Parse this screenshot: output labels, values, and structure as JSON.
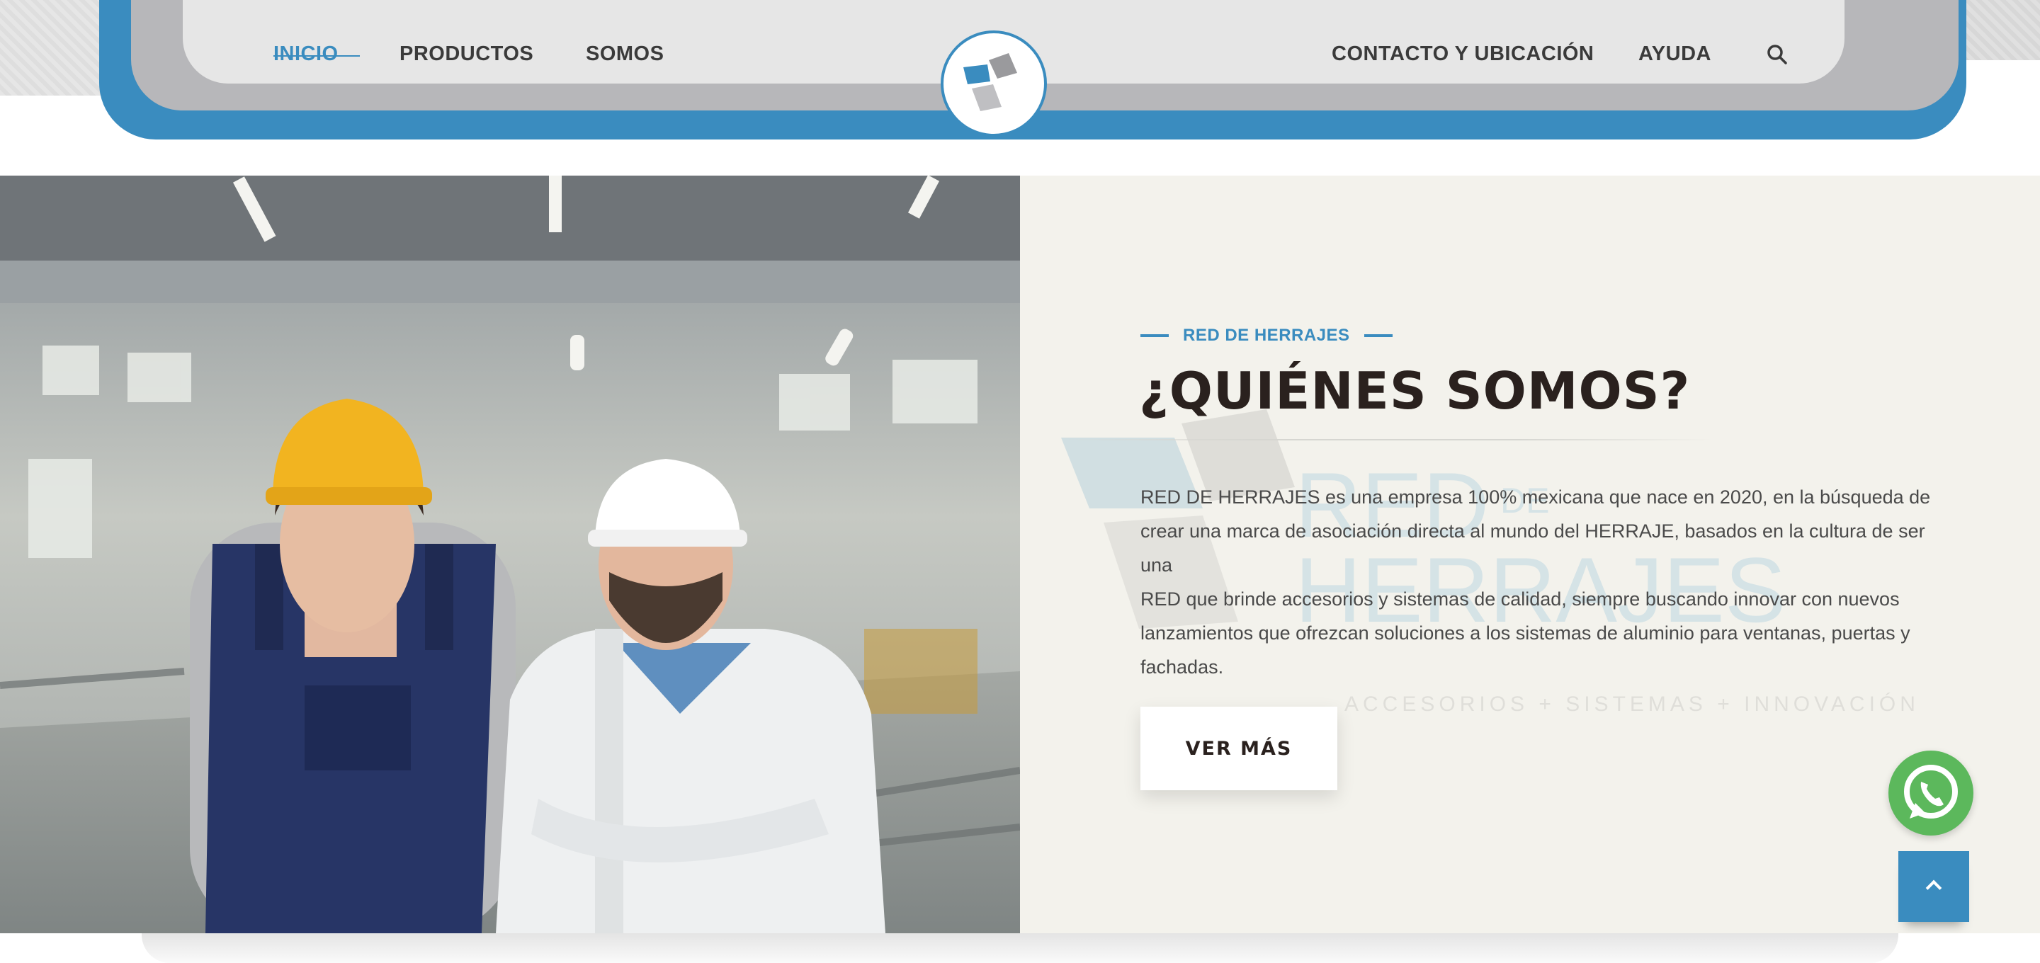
{
  "header": {
    "nav_left": [
      {
        "label": "INICIO",
        "active": true
      },
      {
        "label": "PRODUCTOS",
        "active": false
      },
      {
        "label": "SOMOS",
        "active": false
      }
    ],
    "nav_right": [
      {
        "label": "CONTACTO Y UBICACIÓN"
      },
      {
        "label": "AYUDA"
      }
    ],
    "search_icon": "search-icon",
    "logo_icon": "red-de-herrajes-logo"
  },
  "about": {
    "eyebrow": "RED DE HERRAJES",
    "title": "¿QUIÉNES SOMOS?",
    "paragraph_1": "RED DE HERRAJES es una empresa 100% mexicana que nace en 2020, en la búsqueda de crear una marca de asociación directa al mundo del HERRAJE, basados en la cultura de ser una",
    "paragraph_2": "RED que brinde accesorios y sistemas de calidad, siempre buscando innovar con nuevos lanzamientos que ofrezcan soluciones a los sistemas de aluminio para ventanas, puertas y fachadas.",
    "cta_label": "VER MÁS",
    "watermark": {
      "line1": "RED",
      "line1_small": "DE",
      "line2": "HERRAJES",
      "tagline": "ACCESORIOS + SISTEMAS + INNOVACIÓN"
    }
  },
  "floating": {
    "whatsapp_icon": "whatsapp-icon",
    "scroll_top_icon": "chevron-up-icon"
  },
  "colors": {
    "accent": "#3a8cbf",
    "dark_text": "#2a211e",
    "panel_bg": "#f3f2ec",
    "whatsapp": "#5cb85c"
  }
}
